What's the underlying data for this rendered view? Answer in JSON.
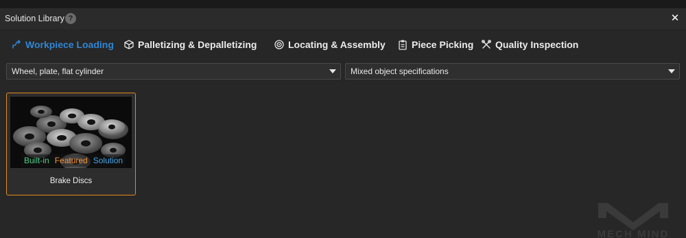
{
  "window": {
    "title": "Solution Library",
    "help_glyph": "?",
    "close_glyph": "✕"
  },
  "tabs": [
    {
      "label": "Workpiece Loading",
      "icon": "workpiece-loading-icon",
      "active": true
    },
    {
      "label": "Palletizing & Depalletizing",
      "icon": "box-icon",
      "active": false
    },
    {
      "label": "Locating & Assembly",
      "icon": "gear-target-icon",
      "active": false
    },
    {
      "label": "Piece Picking",
      "icon": "clipboard-icon",
      "active": false
    },
    {
      "label": "Quality Inspection",
      "icon": "tools-icon",
      "active": false
    }
  ],
  "filters": {
    "shape": "Wheel, plate, flat cylinder",
    "specification": "Mixed object specifications"
  },
  "solutions": [
    {
      "name": "Brake Discs",
      "tags": {
        "builtin": "Built-in",
        "featured": "Featured",
        "solution": "Solution"
      },
      "selected": true
    }
  ],
  "watermark": "MECH MIND",
  "colors": {
    "accent": "#2f86d6",
    "selection_border": "#e38b1c",
    "tag_builtin": "#4fcf8b",
    "tag_featured": "#f5943a",
    "tag_solution": "#43a7e8"
  }
}
